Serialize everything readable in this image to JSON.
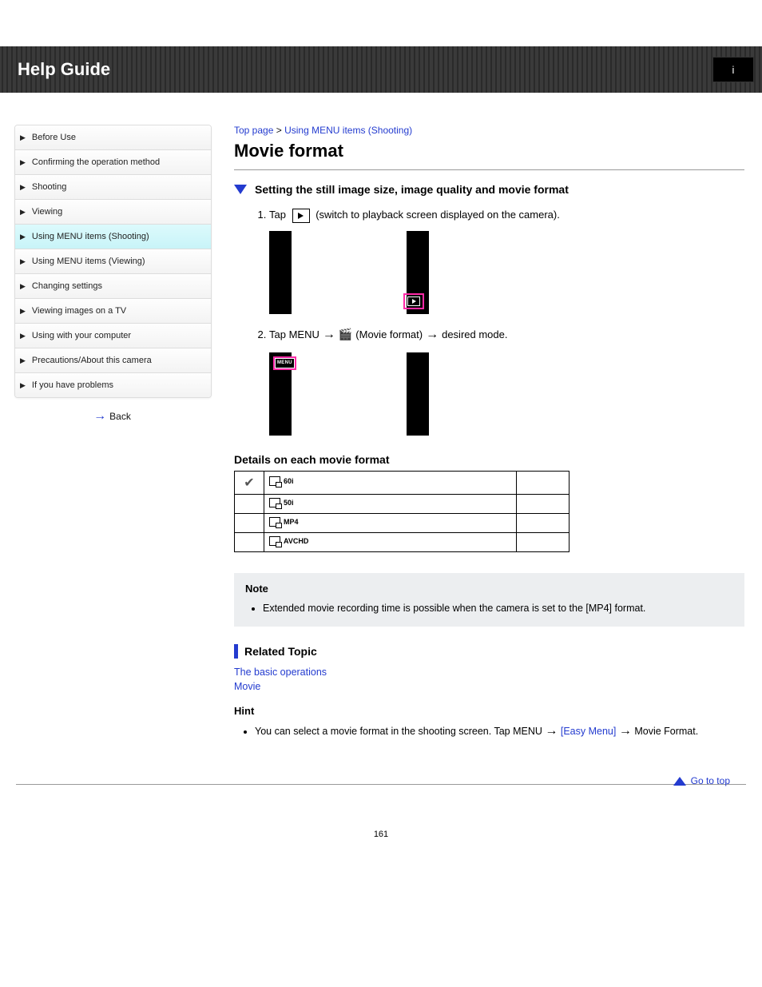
{
  "header": {
    "title": "Help Guide",
    "badge": "i"
  },
  "sidebar": {
    "items": [
      {
        "label": "Before Use"
      },
      {
        "label": "Confirming the operation method"
      },
      {
        "label": "Shooting"
      },
      {
        "label": "Viewing"
      },
      {
        "label": "Using MENU items (Shooting)"
      },
      {
        "label": "Using MENU items (Viewing)"
      },
      {
        "label": "Changing settings"
      },
      {
        "label": "Viewing images on a TV"
      },
      {
        "label": "Using with your computer"
      },
      {
        "label": "Precautions/About this camera"
      },
      {
        "label": "If you have problems"
      }
    ],
    "back": "Back"
  },
  "crumb": {
    "a": "Top page",
    "b": "Using MENU items (Shooting)",
    "sep": ">"
  },
  "title": "Movie format",
  "toggle": "Setting the still image size, image quality and movie format",
  "steps": {
    "s1_a": "Tap ",
    "s1_b": " (switch to playback screen displayed on the camera).",
    "s2_a": "Tap MENU ",
    "s2_b": " (Movie format) ",
    "s2_c": " desired mode."
  },
  "table_head": "Details on each movie format",
  "table": [
    {
      "check": true,
      "suffix": "60i",
      "right": ""
    },
    {
      "check": false,
      "suffix": "50i",
      "right": ""
    },
    {
      "check": false,
      "suffix": "MP4",
      "right": ""
    },
    {
      "check": false,
      "suffix": "AVCHD",
      "right": ""
    }
  ],
  "note": {
    "title": "Note",
    "items": [
      "Extended movie recording time is possible when the camera is set to the [MP4] format."
    ]
  },
  "related": {
    "title": "Related Topic",
    "links": [
      "The basic operations",
      "Movie"
    ]
  },
  "hint": {
    "title": "Hint",
    "body_a": "You can select a movie format in the shooting screen. Tap MENU ",
    "body_b": " ",
    "body_c": " Movie Format.",
    "link": "[Easy Menu]"
  },
  "gotop": "Go to top",
  "pagenum": "161"
}
